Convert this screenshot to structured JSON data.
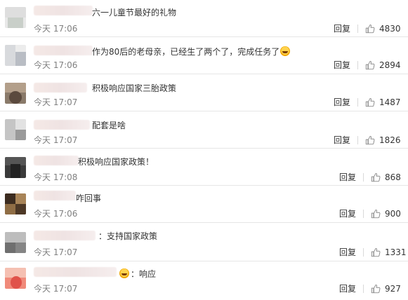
{
  "comments": [
    {
      "text": "六一儿童节最好的礼物",
      "time": "今天 17:06",
      "reply": "回复",
      "likes": "4830",
      "emoji": false
    },
    {
      "text": "作为80后的老母亲，已经生了两个了，完成任务了",
      "time": "今天 17:06",
      "reply": "回复",
      "likes": "2894",
      "emoji": true
    },
    {
      "text": "积极响应国家三胎政策",
      "time": "今天 17:07",
      "reply": "回复",
      "likes": "1487",
      "emoji": false
    },
    {
      "text": "配套是啥",
      "time": "今天 17:07",
      "reply": "回复",
      "likes": "1826",
      "emoji": false
    },
    {
      "text": "积极响应国家政策！",
      "time": "今天 17:08",
      "reply": "回复",
      "likes": "868",
      "emoji": false
    },
    {
      "text": "咋回事",
      "time": "今天 17:06",
      "reply": "回复",
      "likes": "900",
      "emoji": false
    },
    {
      "text": "：支持国家政策",
      "time": "今天 17:07",
      "reply": "回复",
      "likes": "1331",
      "emoji": false
    },
    {
      "text": "：响应",
      "time": "今天 17:07",
      "reply": "回复",
      "likes": "927",
      "emoji": true
    }
  ],
  "icons": {
    "like": "thumbs-up-icon",
    "emoji": "laughing-emoji-icon"
  },
  "colors": {
    "text": "#333333",
    "time": "#808080",
    "divider": "#e6e6e6"
  }
}
